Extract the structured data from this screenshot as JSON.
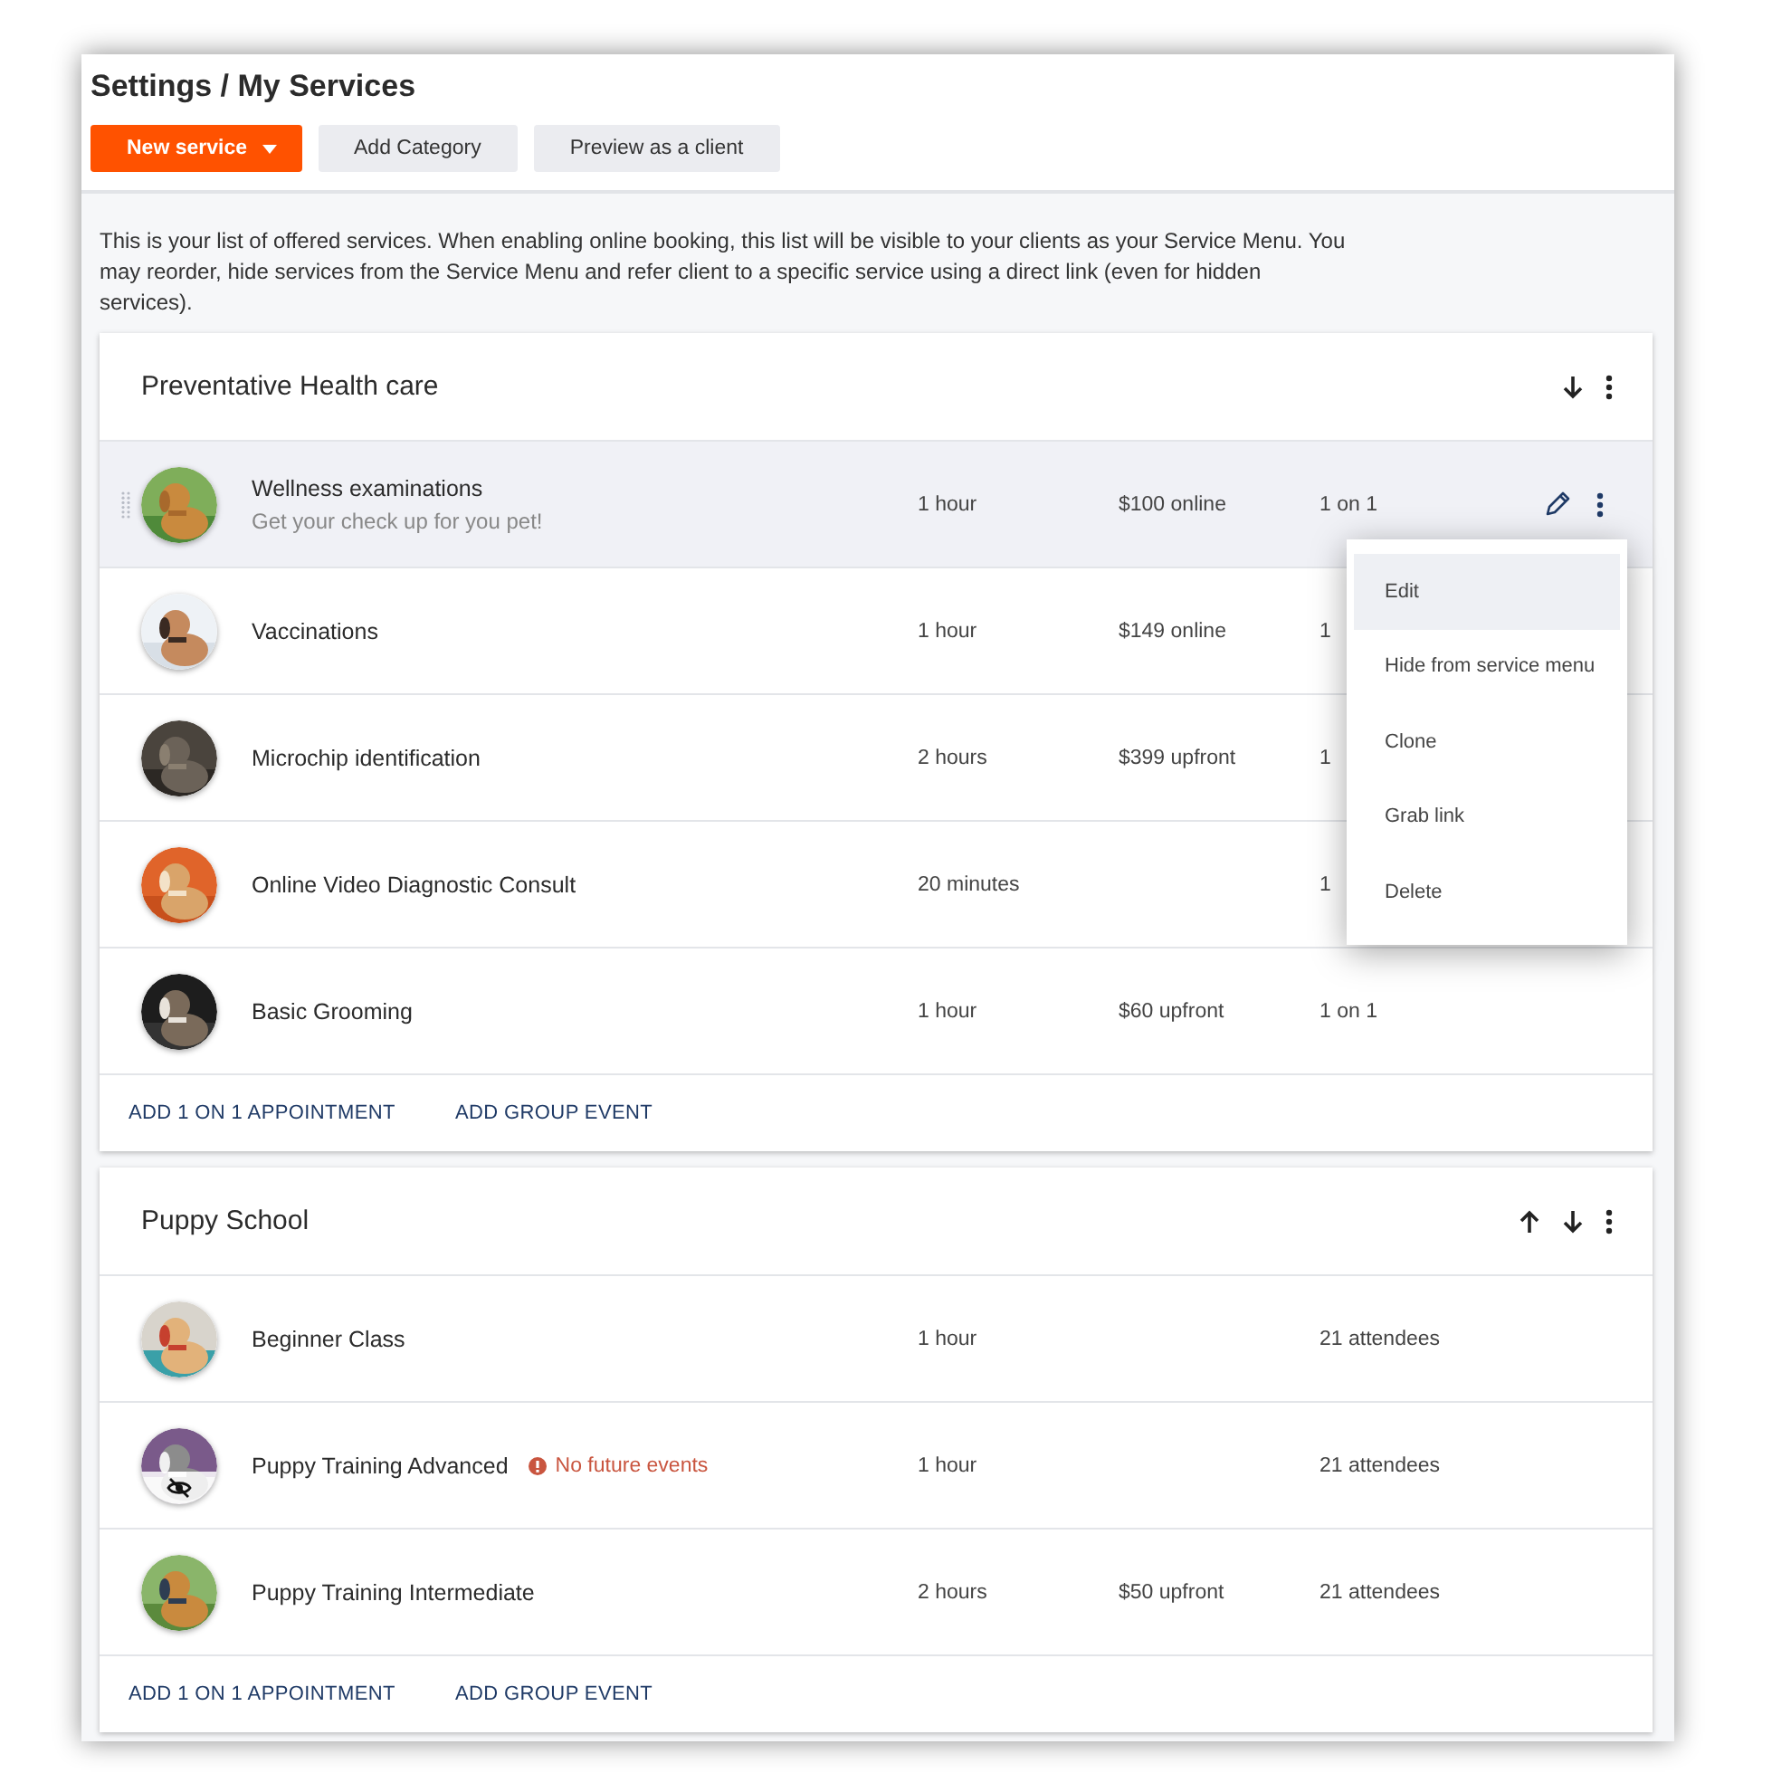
{
  "title": "Settings / My Services",
  "toolbar": [
    {
      "kind": "primary",
      "label": "New service"
    },
    {
      "kind": "secondary",
      "label": "Add Category"
    },
    {
      "kind": "secondary",
      "label": "Preview as a client"
    }
  ],
  "description": "This is your list of offered services. When enabling online booking, this list will be visible to your clients as your Service Menu. You may reorder, hide services from the Service Menu and refer client to a specific service using a direct link (even for hidden services).",
  "categories": [
    {
      "name": "Preventative Health care",
      "can_move_up": false,
      "can_move_down": true,
      "services": [
        {
          "name": "Wellness examinations",
          "subtitle": "Get your check up for you pet!",
          "duration": "1 hour",
          "price": "$100 online",
          "type": "1 on 1",
          "selected": true,
          "hidden": false
        },
        {
          "name": "Vaccinations",
          "duration": "1 hour",
          "price": "$149 online",
          "type": "1",
          "selected": false,
          "hidden": false
        },
        {
          "name": "Microchip identification",
          "duration": "2 hours",
          "price": "$399 upfront",
          "type": "1",
          "selected": false,
          "hidden": false
        },
        {
          "name": "Online Video Diagnostic Consult",
          "duration": "20 minutes",
          "type": "1",
          "selected": false,
          "hidden": false
        },
        {
          "name": "Basic Grooming",
          "duration": "1 hour",
          "price": "$60 upfront",
          "type": "1 on 1",
          "selected": false,
          "hidden": false
        }
      ],
      "actions": [
        "ADD 1 ON 1 APPOINTMENT",
        "ADD GROUP EVENT"
      ]
    },
    {
      "name": "Puppy School",
      "can_move_up": true,
      "can_move_down": true,
      "services": [
        {
          "name": "Beginner Class",
          "duration": "1 hour",
          "type": "21 attendees",
          "selected": false,
          "hidden": false
        },
        {
          "name": "Puppy Training Advanced",
          "warning": "No future events",
          "duration": "1 hour",
          "type": "21 attendees",
          "selected": false,
          "hidden": true
        },
        {
          "name": "Puppy Training Intermediate",
          "duration": "2 hours",
          "price": "$50 upfront",
          "type": "21 attendees",
          "selected": false,
          "hidden": false
        }
      ],
      "actions": [
        "ADD 1 ON 1 APPOINTMENT",
        "ADD GROUP EVENT"
      ]
    }
  ],
  "context_menu": [
    {
      "label": "Edit",
      "selected": true
    },
    {
      "label": "Hide from service menu",
      "selected": false
    },
    {
      "label": "Clone",
      "selected": false
    },
    {
      "label": "Grab link",
      "selected": false
    },
    {
      "label": "Delete",
      "selected": false
    }
  ]
}
